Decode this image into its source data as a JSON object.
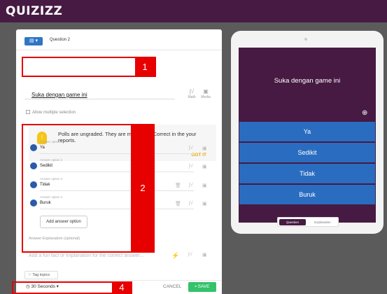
{
  "app": {
    "logo": "QUIZIZZ"
  },
  "editor": {
    "type_icon": "▤ ▾",
    "question_label": "Question 2",
    "question_text": "Suka dengan game ini",
    "tools": {
      "math": "Math",
      "media": "Media"
    },
    "allow_multiple": "Allow multiple selection",
    "notice": "Polls are ungraded. They are marked as Correct in the your reports.",
    "got_it": "GOT IT",
    "answers": [
      {
        "label": "Answer option 1",
        "value": "Ya"
      },
      {
        "label": "Answer option 2",
        "value": "Sedikit"
      },
      {
        "label": "Answer option 3",
        "value": "Tidak"
      },
      {
        "label": "Answer option 4",
        "value": "Buruk"
      }
    ],
    "add_answer": "Add answer option",
    "explanation_title": "Answer Explanation (optional)",
    "explanation_placeholder": "Add a fun fact or explanation for the correct answer...",
    "tag_topics": "Tag topics",
    "timer": "30 Seconds",
    "cancel": "CANCEL",
    "save": "SAVE"
  },
  "preview": {
    "question": "Suka dengan game ini",
    "options": [
      "Ya",
      "Sedikit",
      "Tidak",
      "Buruk"
    ],
    "tabs": [
      "Question",
      "Explanation"
    ]
  },
  "annotations": [
    "1",
    "2",
    "4"
  ],
  "colors": {
    "topbar": "#461a42",
    "accent": "#e60000",
    "option": "#2a6dc0",
    "save": "#34c26a"
  }
}
